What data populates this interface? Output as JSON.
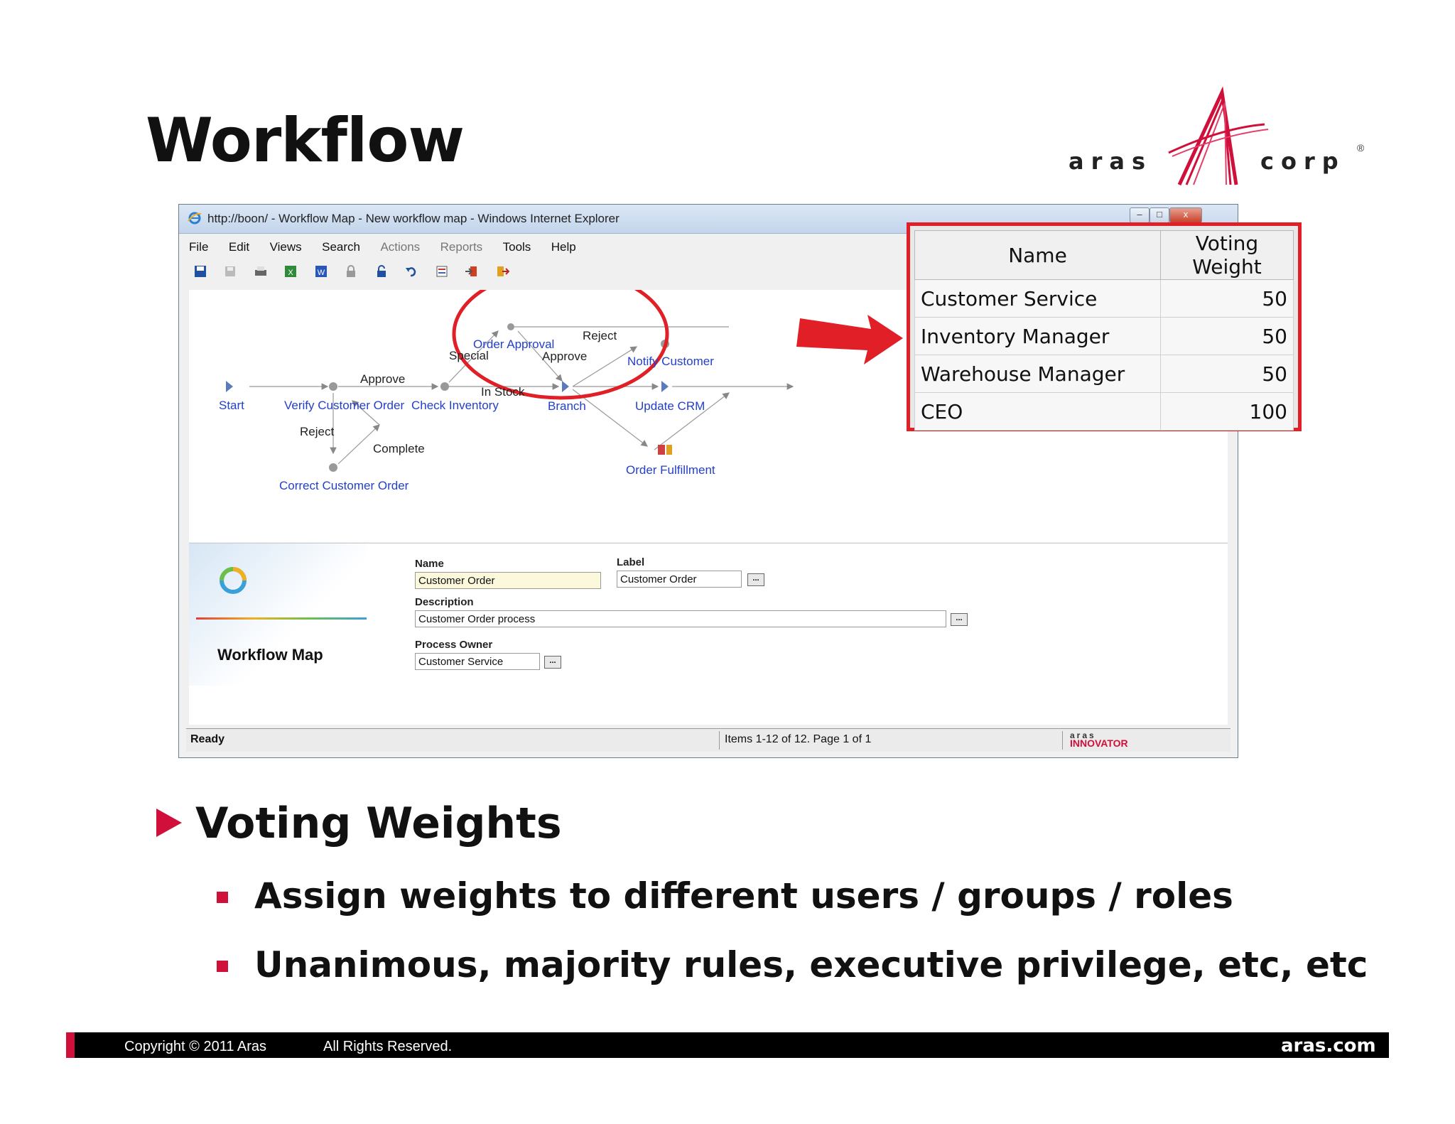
{
  "slide": {
    "title": "Workflow",
    "logo": {
      "left": "aras",
      "right": "corp",
      "registered": "®"
    },
    "bullet": "Voting Weights",
    "sub_bullets": [
      "Assign weights to different users / groups / roles",
      "Unanimous, majority rules, executive privilege, etc, etc"
    ],
    "footer": {
      "copyright": "Copyright © 2011 Aras",
      "rights": "All Rights Reserved.",
      "site": "aras.com"
    },
    "accent_color": "#d0103a"
  },
  "browser": {
    "title": "http://boon/ - Workflow Map - New workflow map - Windows Internet Explorer",
    "window_buttons": [
      "–",
      "□",
      "x"
    ],
    "menu": [
      "File",
      "Edit",
      "Views",
      "Search",
      "Actions",
      "Reports",
      "Tools",
      "Help"
    ],
    "toolbar_icons": [
      "save-icon",
      "save-as-icon",
      "print-icon",
      "excel-icon",
      "word-icon",
      "lock-icon",
      "unlock-icon",
      "undo-icon",
      "properties-icon",
      "import-icon",
      "export-icon"
    ]
  },
  "workflow_map": {
    "nodes": {
      "start": "Start",
      "verify": "Verify Customer Order",
      "check": "Check Inventory",
      "approval": "Order Approval",
      "branch": "Branch",
      "notify": "Notify Customer",
      "update": "Update CRM",
      "fulfill": "Order Fulfillment",
      "correct": "Correct Customer Order"
    },
    "paths": {
      "approve1": "Approve",
      "reject1": "Reject",
      "complete": "Complete",
      "special": "Special",
      "instock": "In Stock",
      "approve2": "Approve",
      "reject2": "Reject"
    }
  },
  "form": {
    "side_title": "Workflow Map",
    "name_label": "Name",
    "name_value": "Customer Order",
    "label_label": "Label",
    "label_value": "Customer Order",
    "description_label": "Description",
    "description_value": "Customer Order process",
    "owner_label": "Process Owner",
    "owner_value": "Customer Service",
    "ellipsis": "..."
  },
  "status": {
    "ready": "Ready",
    "items": "Items 1-12 of 12. Page 1 of 1",
    "brand_top": "aras",
    "brand_bottom": "INNOVATOR"
  },
  "voting_weights": {
    "headers": [
      "Name",
      "Voting Weight"
    ],
    "rows": [
      {
        "name": "Customer Service",
        "weight": "50"
      },
      {
        "name": "Inventory Manager",
        "weight": "50"
      },
      {
        "name": "Warehouse Manager",
        "weight": "50"
      },
      {
        "name": "CEO",
        "weight": "100"
      }
    ]
  }
}
